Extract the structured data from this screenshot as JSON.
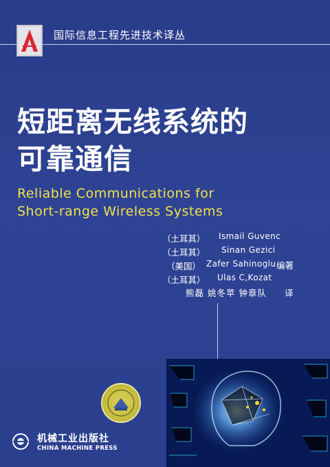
{
  "series": {
    "title": "国际信息工程先进技术译丛"
  },
  "title_cn": [
    "短距离无线系统的",
    "可靠通信"
  ],
  "title_en": [
    "Reliable Communications for",
    "Short-range Wireless Systems"
  ],
  "authors": [
    {
      "country": "（土耳其）",
      "name": "Ismail Guvenc"
    },
    {
      "country": "（土耳其）",
      "name": "Sinan Gezici"
    },
    {
      "country": "（美国）",
      "name": "Zafer Sahinoglu"
    },
    {
      "country": "（土耳其）",
      "name": "Ulas C,Kozat"
    }
  ],
  "editor_role": "编著",
  "translators": "熊磊  姚冬苹  钟章队",
  "translator_role": "译",
  "publisher": {
    "cn": "机械工业出版社",
    "en": "CHINA MACHINE PRESS"
  },
  "colors": {
    "background": "#2c3e8c",
    "english_title": "#f2e24a",
    "text": "#ffffff"
  }
}
